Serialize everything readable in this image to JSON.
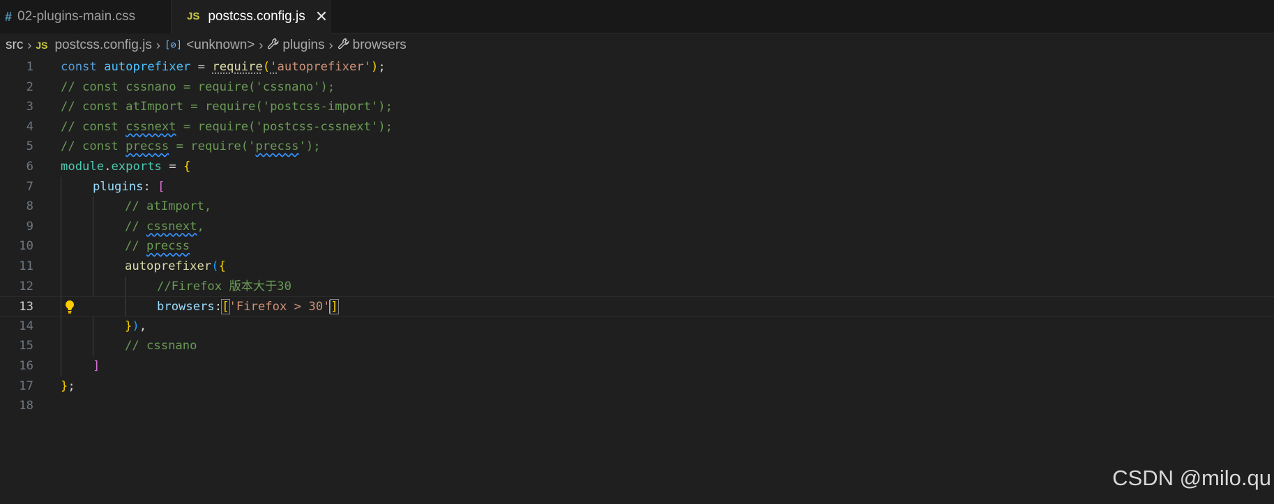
{
  "tabs": [
    {
      "icon": "#",
      "label": "02-plugins-main.css",
      "active": false
    },
    {
      "icon": "JS",
      "label": "postcss.config.js",
      "active": true,
      "close": "✕"
    }
  ],
  "breadcrumb": {
    "items": [
      "src",
      "postcss.config.js",
      "<unknown>",
      "plugins",
      "browsers"
    ],
    "separator": "›"
  },
  "editor": {
    "line_numbers": [
      "1",
      "2",
      "3",
      "4",
      "5",
      "6",
      "7",
      "8",
      "9",
      "10",
      "11",
      "12",
      "13",
      "14",
      "15",
      "16",
      "17",
      "18"
    ],
    "current_line": 13,
    "lines": {
      "l1": {
        "kw": "const",
        "var": "autoprefixer",
        "eq": " = ",
        "fn": "require",
        "open": "(",
        "q1": "'",
        "str": "autoprefixer",
        "q2": "'",
        "close": ")",
        "semi": ";"
      },
      "l2": "// const cssnano = require('cssnano');",
      "l3": "// const atImport = require('postcss-import');",
      "l4": {
        "a": "// const ",
        "b": "cssnext",
        "c": " = require('postcss-cssnext');"
      },
      "l5": {
        "a": "// const ",
        "b": "precss",
        "c": " = require('",
        "d": "precss",
        "e": "');"
      },
      "l6": {
        "mod": "module",
        "dot": ".",
        "prop": "exports",
        "eq": " = ",
        "brace": "{"
      },
      "l7": {
        "prop": "plugins",
        "colon": ": ",
        "bracket": "["
      },
      "l8": "// atImport,",
      "l9": {
        "a": "// ",
        "b": "cssnext",
        "c": ","
      },
      "l10": {
        "a": "// ",
        "b": "precss"
      },
      "l11": {
        "fn": "autoprefixer",
        "paren": "(",
        "brace": "{"
      },
      "l12": "//Firefox 版本大于30",
      "l13": {
        "prop": "browsers",
        "colon": ":",
        "open": "[",
        "str": "'Firefox > 30'",
        "close": "]"
      },
      "l14": {
        "brace": "}",
        "paren": ")",
        "comma": ","
      },
      "l15": "// cssnano",
      "l16": "]",
      "l17": {
        "brace": "}",
        "semi": ";"
      }
    }
  },
  "icons": {
    "css_file": "#",
    "js_file": "JS",
    "symbol": "[⊘]",
    "wrench": "🔧",
    "lightbulb": "💡"
  },
  "watermark": "CSDN @milo.qu",
  "colors": {
    "editor_bg": "#1f1f1f",
    "tabbar_bg": "#181818",
    "keyword": "#569cd6",
    "variable": "#4fc1ff",
    "function": "#dcdcaa",
    "string": "#ce9178",
    "comment": "#6a9955",
    "property": "#9cdcfe",
    "bracket_gold": "#ffd700",
    "bracket_purple": "#da70d6",
    "bracket_blue": "#179fff"
  }
}
